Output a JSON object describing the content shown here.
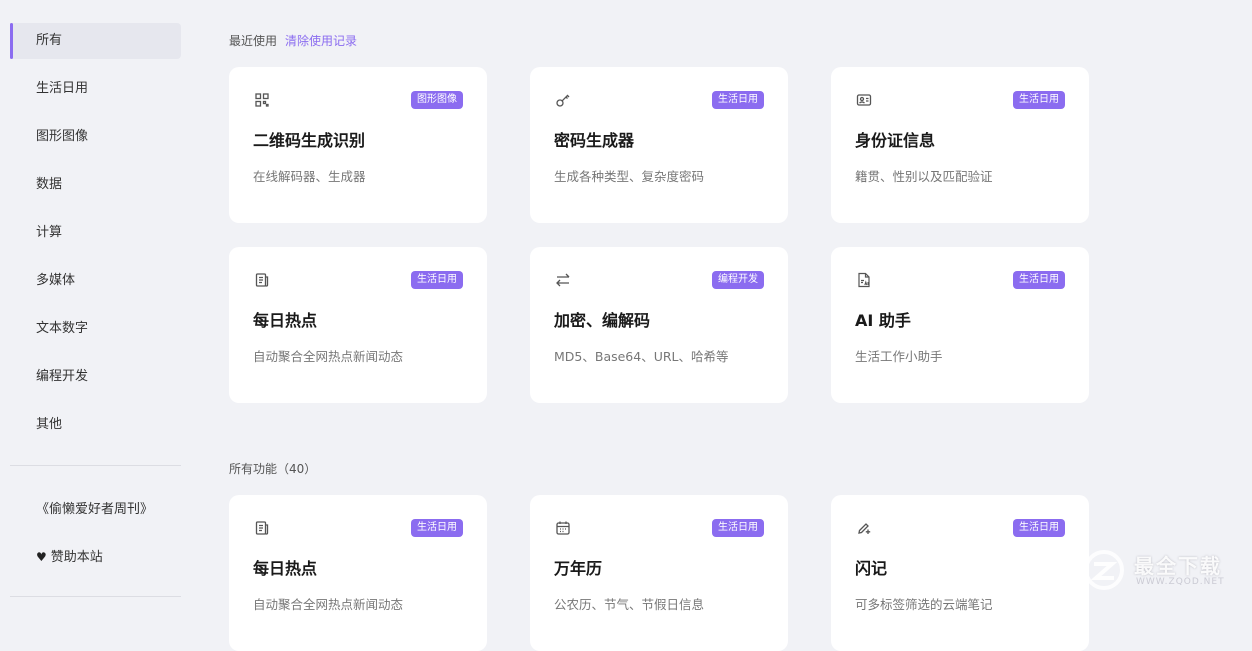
{
  "sidebar": {
    "items": [
      {
        "label": "所有",
        "active": true
      },
      {
        "label": "生活日用"
      },
      {
        "label": "图形图像"
      },
      {
        "label": "数据"
      },
      {
        "label": "计算"
      },
      {
        "label": "多媒体"
      },
      {
        "label": "文本数字"
      },
      {
        "label": "编程开发"
      },
      {
        "label": "其他"
      }
    ],
    "extras": [
      {
        "label": "《偷懒爱好者周刊》"
      },
      {
        "label": "赞助本站",
        "icon": "heart-icon"
      }
    ]
  },
  "recent": {
    "title": "最近使用",
    "clear_label": "清除使用记录",
    "cards": [
      {
        "icon": "qrcode-icon",
        "badge": "图形图像",
        "title": "二维码生成识别",
        "desc": "在线解码器、生成器"
      },
      {
        "icon": "key-icon",
        "badge": "生活日用",
        "title": "密码生成器",
        "desc": "生成各种类型、复杂度密码"
      },
      {
        "icon": "id-card-icon",
        "badge": "生活日用",
        "title": "身份证信息",
        "desc": "籍贯、性别以及匹配验证"
      },
      {
        "icon": "news-icon",
        "badge": "生活日用",
        "title": "每日热点",
        "desc": "自动聚合全网热点新闻动态"
      },
      {
        "icon": "swap-arrows-icon",
        "badge": "编程开发",
        "title": "加密、编解码",
        "desc": "MD5、Base64、URL、哈希等"
      },
      {
        "icon": "ai-file-icon",
        "badge": "生活日用",
        "title": "AI 助手",
        "desc": "生活工作小助手"
      }
    ]
  },
  "all": {
    "title": "所有功能（40）",
    "cards": [
      {
        "icon": "news-icon",
        "badge": "生活日用",
        "title": "每日热点",
        "desc": "自动聚合全网热点新闻动态"
      },
      {
        "icon": "calendar-icon",
        "badge": "生活日用",
        "title": "万年历",
        "desc": "公农历、节气、节假日信息"
      },
      {
        "icon": "pen-plus-icon",
        "badge": "生活日用",
        "title": "闪记",
        "desc": "可多标签筛选的云端笔记"
      }
    ]
  },
  "watermark": {
    "text": "最全下载",
    "sub": "WWW.ZQOD.NET"
  },
  "colors": {
    "accent": "#8b6cf0",
    "background": "#f1f2f6",
    "card": "#ffffff"
  }
}
